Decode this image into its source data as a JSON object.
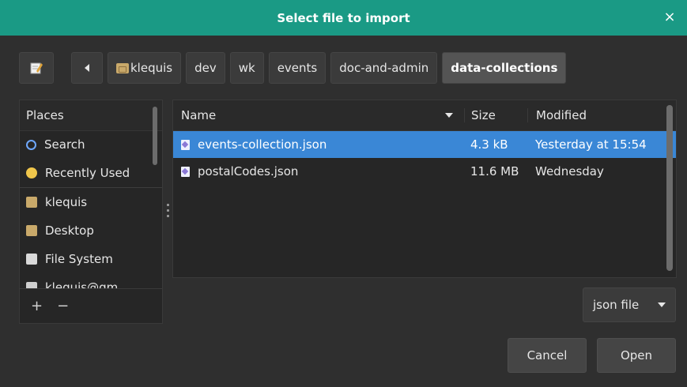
{
  "dialog": {
    "title": "Select file to import",
    "close_label": "×"
  },
  "pathbar": {
    "crumbs": [
      "klequis",
      "dev",
      "wk",
      "events",
      "doc-and-admin",
      "data-collections"
    ],
    "selected": "data-collections"
  },
  "places": {
    "header": "Places",
    "items": [
      {
        "label": "Search",
        "icon": "search-icon"
      },
      {
        "label": "Recently Used",
        "icon": "clock-icon"
      },
      {
        "label": "klequis",
        "icon": "home-folder-icon"
      },
      {
        "label": "Desktop",
        "icon": "desktop-folder-icon"
      },
      {
        "label": "File System",
        "icon": "drive-icon"
      },
      {
        "label": "klequis@gm",
        "icon": "network-icon"
      }
    ],
    "add_label": "+",
    "remove_label": "−"
  },
  "files": {
    "columns": {
      "name": "Name",
      "size": "Size",
      "modified": "Modified"
    },
    "rows": [
      {
        "name": "events-collection.json",
        "size": "4.3 kB",
        "modified": "Yesterday at 15:54",
        "selected": true
      },
      {
        "name": "postalCodes.json",
        "size": "11.6 MB",
        "modified": "Wednesday",
        "selected": false
      }
    ]
  },
  "filter": {
    "value": "json file"
  },
  "buttons": {
    "cancel": "Cancel",
    "open": "Open"
  },
  "colors": {
    "titlebar": "#1a9a85",
    "selection": "#3a87d6",
    "background": "#2f2f2f"
  }
}
